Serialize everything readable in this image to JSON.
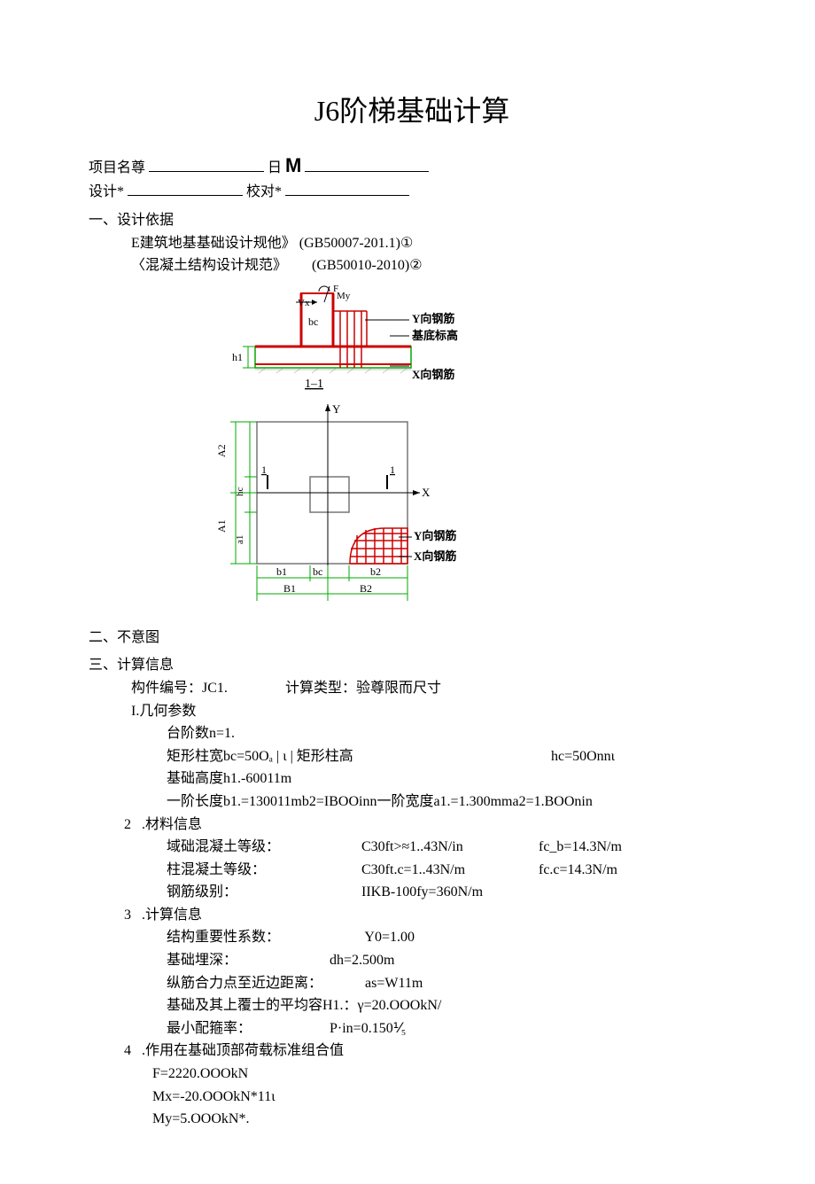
{
  "title": "J6阶梯基础计算",
  "header": {
    "project_label": "项目名尊",
    "date_prefix": "日",
    "date_big": "M",
    "design_label": "设计*",
    "check_label": "校对*"
  },
  "sec1": {
    "heading": "一、设计依据",
    "line1": "E建筑地基基础设计规他》 (GB50007-201.1)①",
    "line2a": "〈混凝土结构设计规范》",
    "line2b": "(GB50010-2010)②"
  },
  "diagram": {
    "labels": {
      "F": "F",
      "My": "My",
      "Vx": "Vx",
      "bc_top": "bc",
      "h1": "h1",
      "sec11": "1–1",
      "y_rebar": "Y向钢筋",
      "base_label": "基底标高",
      "x_rebar_top": "X向钢筋",
      "Y": "Y",
      "X": "X",
      "A2": "A2",
      "A1": "A1",
      "a1_left": "a1",
      "hc_left": "hc",
      "one_left": "1",
      "one_right": "1",
      "y_rebar2": "Y向钢筋",
      "x_rebar2": "X向钢筋",
      "b1": "b1",
      "bc_bot": "bc",
      "b2": "b2",
      "B1": "B1",
      "B2": "B2"
    }
  },
  "sec2": {
    "heading": "二、不意图"
  },
  "sec3": {
    "heading": "三、计算信息",
    "member": "构件编号：JC1.",
    "calc_type": "计算类型：验尊限而尺寸",
    "p1": {
      "heading": "I.几何参数",
      "l1": "台阶数n=1.",
      "l2a": "矩形柱宽bc=50Oₐ | ι | 矩形柱高",
      "l2b": "hc=50Onnι",
      "l3": "基础高度h1.-60011m",
      "l4": "一阶长度b1.=130011mb2=IBOOinn一阶宽度a1.=1.300mma2=1.BOOnin"
    },
    "p2": {
      "num": "2",
      "heading": ".材料信息",
      "r1c1": "域础混凝土等级：",
      "r1c2": "C30ft>≈1..43N/in",
      "r1c3": "fc_b=14.3N/m",
      "r2c1": "柱混凝土等级：",
      "r2c2": "C30ft.c=1..43N/m",
      "r2c3": "fc.c=14.3N/m",
      "r3c1": "钢筋级别：",
      "r3c2": "IIKB-100fy=360N/m"
    },
    "p3": {
      "num": "3",
      "heading": ".计算信息",
      "r1a": "结构重要性系数：",
      "r1b": "Y0=1.00",
      "r2a": "基础埋深：",
      "r2b": "dh=2.500m",
      "r3a": "纵筋合力点至近边距离：",
      "r3b": "as=W11m",
      "r4": "基础及其上覆士的平均容H1.：γ=20.OOOkN/",
      "r5a": "最小配箍率：",
      "r5b": "P·in=0.150⅟₅"
    },
    "p4": {
      "num": "4",
      "heading": ".作用在基础顶部荷载标准组合值",
      "l1": "F=2220.OOOkN",
      "l2": "Mx=-20.OOOkN*11ι",
      "l3": "My=5.OOOkN*."
    }
  }
}
